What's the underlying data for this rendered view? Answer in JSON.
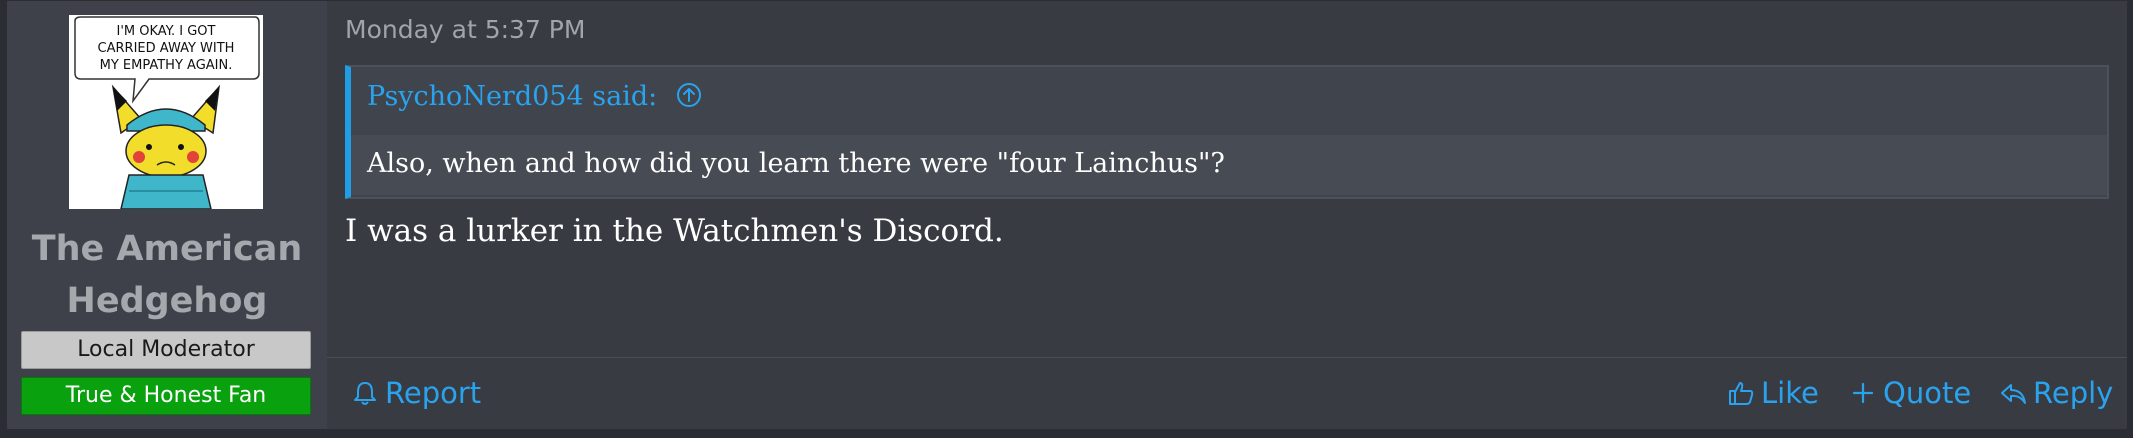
{
  "user": {
    "name": "The American Hedgehog",
    "name_line1": "The American",
    "name_line2": "Hedgehog",
    "avatar_caption": [
      "I'M OKAY. I GOT",
      "CARRIED AWAY WITH",
      "MY EMPATHY AGAIN."
    ],
    "banners": [
      "Local Moderator",
      "True & Honest Fan"
    ]
  },
  "post": {
    "timestamp": "Monday at 5:37 PM",
    "quote": {
      "author_said": "PsychoNerd054 said:",
      "text": "Also, when and how did you learn there were \"four Lainchus\"?"
    },
    "message": "I was a lurker in the Watchmen's Discord."
  },
  "actions": {
    "report": "Report",
    "like": "Like",
    "quote": "Quote",
    "reply": "Reply"
  },
  "colors": {
    "accent": "#2aa3ef",
    "moderator_banner": "#c8c8c8",
    "fan_banner": "#0aa10f"
  }
}
